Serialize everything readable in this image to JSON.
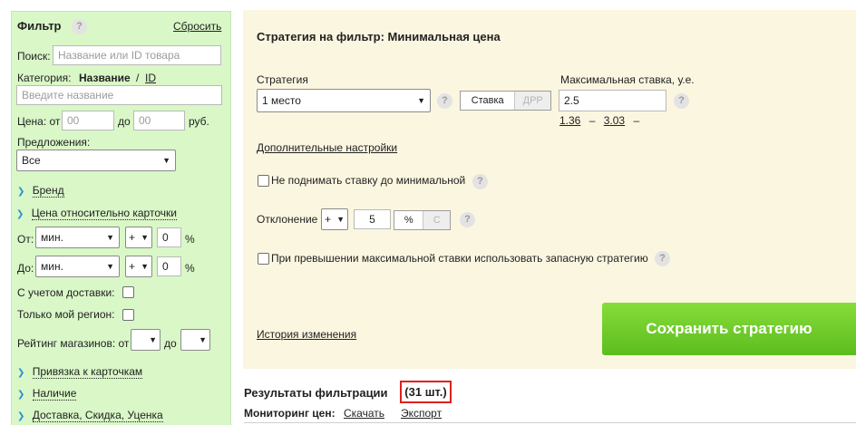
{
  "filter": {
    "title": "Фильтр",
    "reset": "Сбросить",
    "search_label": "Поиск:",
    "search_placeholder": "Название или ID товара",
    "category_label": "Категория:",
    "category_name": "Название",
    "category_sep": "/",
    "category_id": "ID",
    "category_placeholder": "Введите название",
    "price_label": "Цена: от",
    "price_from": "00",
    "price_to_label": "до",
    "price_to": "00",
    "price_unit": "руб.",
    "offers_label": "Предложения:",
    "offers_value": "Все",
    "brand": "Бренд",
    "card_price": "Цена относительно карточки",
    "from_label": "От:",
    "to_label": "До:",
    "from_select": "мин.",
    "from_sign": "+",
    "from_value": "0",
    "to_select": "мин.",
    "to_sign": "+",
    "to_value": "0",
    "percent": "%",
    "delivery_label": "С учетом доставки:",
    "region_label": "Только мой регион:",
    "rating_label": "Рейтинг магазинов: от",
    "rating_to_label": "до",
    "card_binding": "Привязка к карточкам",
    "availability": "Наличие",
    "delivery_discount": "Доставка, Скидка, Уценка"
  },
  "strategy": {
    "title": "Стратегия на фильтр: Минимальная цена",
    "strategy_label": "Стратегия",
    "strategy_value": "1 место",
    "seg_bid": "Ставка",
    "seg_drr": "ДРР",
    "max_bid_label": "Максимальная ставка, у.е.",
    "max_bid_value": "2.5",
    "bid_hint_1": "1.36",
    "bid_hint_dash1": "–",
    "bid_hint_2": "3.03",
    "bid_hint_dash2": "–",
    "extra_settings": "Дополнительные настройки",
    "no_raise_label": "Не поднимать ставку до минимальной",
    "deviation_label": "Отклонение",
    "deviation_sign": "+",
    "deviation_value": "5",
    "dev_percent": "%",
    "dev_c": "С",
    "fallback_label": "При превышении максимальной ставки использовать запасную стратегию",
    "history": "История изменения",
    "save": "Сохранить стратегию",
    "qmark": "?"
  },
  "results": {
    "title": "Результаты фильтрации",
    "count": "(31 шт.)",
    "monitoring_label": "Мониторинг цен:",
    "download": "Скачать",
    "export": "Экспорт"
  },
  "colors": {
    "filter_bg": "#d9f7c7",
    "strategy_bg": "#fbf6e0",
    "save_green": "#6ccb28",
    "highlight_red": "#e0201c",
    "arrow_blue": "#2a8fd6"
  }
}
